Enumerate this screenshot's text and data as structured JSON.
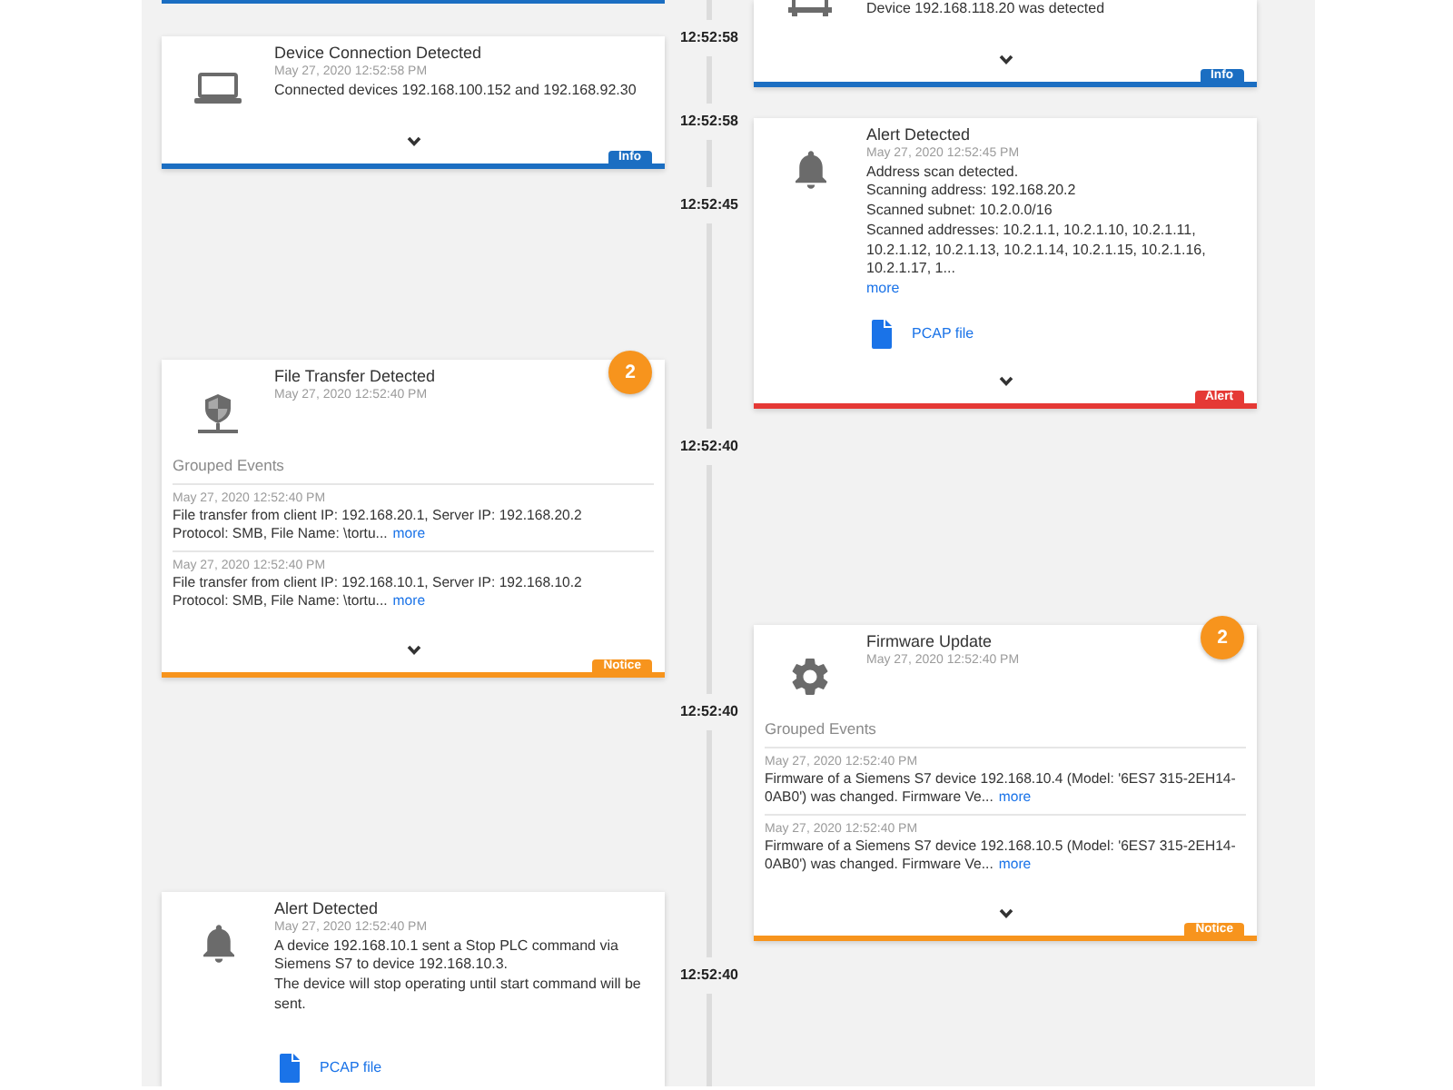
{
  "timeline": {
    "left": [
      {
        "kind": "edge",
        "color": "#1b6ec2"
      },
      {
        "kind": "connection",
        "title": "Device Connection Detected",
        "date": "May 27, 2020 12:52:58 PM",
        "description": "Connected devices 192.168.100.152 and 192.168.92.30",
        "color": "#1b6ec2",
        "tag": "Info"
      },
      {
        "kind": "transfer",
        "count": "2",
        "title": "File Transfer Detected",
        "date": "May 27, 2020 12:52:40 PM",
        "group_heading": "Grouped Events",
        "events": [
          {
            "date": "May 27, 2020 12:52:40 PM",
            "text": "File transfer from client IP: 192.168.20.1, Server IP: 192.168.20.2\nProtocol: SMB, File Name: \\tortu...",
            "more": "more"
          },
          {
            "date": "May 27, 2020 12:52:40 PM",
            "text": "File transfer from client IP: 192.168.10.1, Server IP: 192.168.10.2\nProtocol: SMB, File Name: \\tortu...",
            "more": "more"
          }
        ],
        "color": "#f7941d",
        "tag": "Notice"
      },
      {
        "kind": "alert",
        "title": "Alert Detected",
        "date": "May 27, 2020 12:52:40 PM",
        "description": "A device 192.168.10.1 sent a Stop PLC command via Siemens S7 to device 192.168.10.3.\nThe device will stop operating until start command will be sent.",
        "attachment": "PCAP file"
      }
    ],
    "timestamps": [
      "12:52:58",
      "12:52:58",
      "12:52:45",
      "12:52:40",
      "12:52:40",
      "12:52:40"
    ],
    "right": [
      {
        "kind": "detection",
        "description": "Device 192.168.118.20 was detected",
        "color": "#1b6ec2",
        "tag": "Info"
      },
      {
        "kind": "alert",
        "title": "Alert Detected",
        "date": "May 27, 2020 12:52:45 PM",
        "description": "Address scan detected.\nScanning address: 192.168.20.2\nScanned subnet: 10.2.0.0/16\nScanned addresses: 10.2.1.1, 10.2.1.10, 10.2.1.11, 10.2.1.12, 10.2.1.13, 10.2.1.14, 10.2.1.15, 10.2.1.16, 10.2.1.17, 1...",
        "more": "more",
        "attachment": "PCAP file",
        "color": "#e53935",
        "tag": "Alert"
      },
      {
        "kind": "firmware",
        "count": "2",
        "title": "Firmware Update",
        "date": "May 27, 2020 12:52:40 PM",
        "group_heading": "Grouped Events",
        "events": [
          {
            "date": "May 27, 2020 12:52:40 PM",
            "text": "Firmware of a Siemens S7 device 192.168.10.4 (Model: '6ES7 315-2EH14-0AB0') was changed. Firmware Ve...",
            "more": "more"
          },
          {
            "date": "May 27, 2020 12:52:40 PM",
            "text": "Firmware of a Siemens S7 device 192.168.10.5 (Model: '6ES7 315-2EH14-0AB0') was changed. Firmware Ve...",
            "more": "more"
          }
        ],
        "color": "#f7941d",
        "tag": "Notice"
      }
    ]
  }
}
